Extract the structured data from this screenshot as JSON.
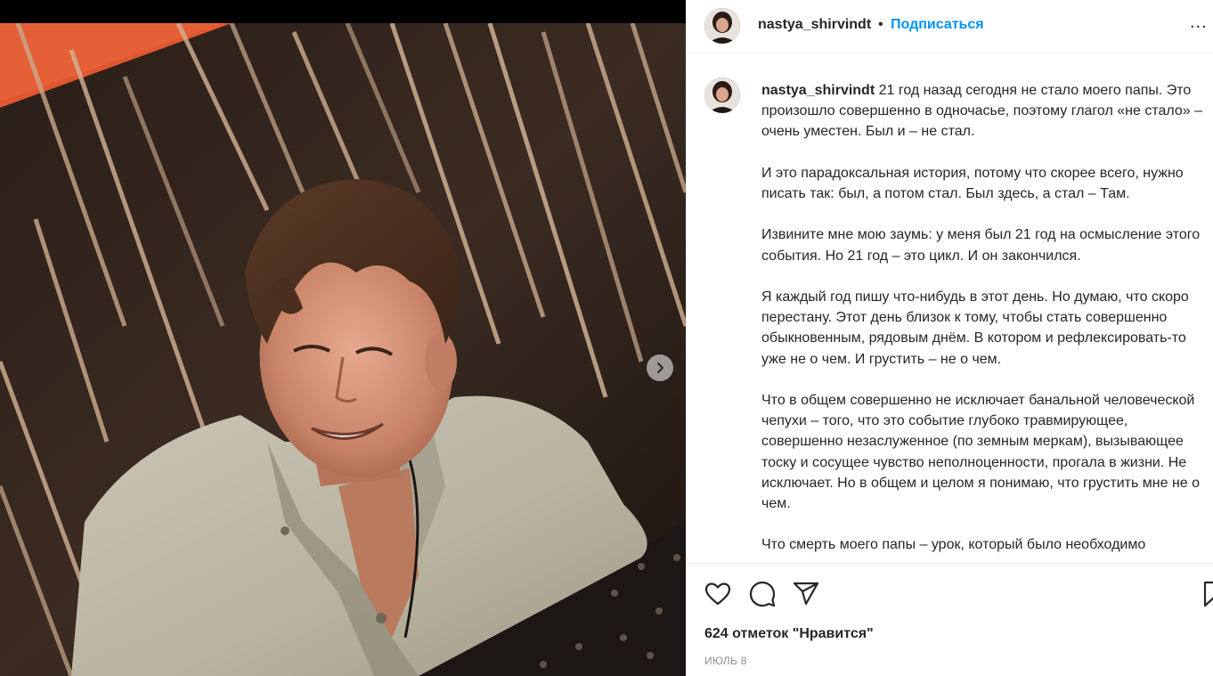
{
  "post": {
    "username": "nastya_shirvindt",
    "separator": "•",
    "follow_label": "Подписаться",
    "more_label": "...",
    "caption_user": "nastya_shirvindt",
    "caption_paragraphs": [
      "21 год назад сегодня не стало моего папы. Это произошло совершенно в одночасье, поэтому глагол «не стало» – очень уместен. Был и – не стал.",
      "И это парадоксальная история, потому что скорее всего, нужно писать так: был, а потом стал. Был здесь, а стал – Там.",
      "Извините мне мою заумь: у меня был 21 год на осмысление этого события. Но 21 год – это цикл. И он закончился.",
      "Я каждый год пишу что-нибудь в этот день. Но думаю, что скоро перестану. Этот день близок к тому, чтобы стать совершенно обыкновенным, рядовым днём. В котором и рефлексировать-то уже не о чем. И грустить – не о чем.",
      "Что в общем совершенно не исключает банальной человеческой чепухи – того, что это событие глубоко травмирующее, совершенно незаслуженное (по земным меркам), вызывающее тоску и сосущее чувство неполноценности, прогала в жизни. Не исключает. Но в общем и целом я понимаю, что грустить мне не о чем.",
      "Что смерть моего папы – урок, который было необходимо"
    ],
    "likes_text": "624 отметок \"Нравится\"",
    "date_text": "Июль 8"
  },
  "icons": {
    "like": "heart-icon",
    "comment": "comment-icon",
    "share": "paper-plane-icon",
    "save": "bookmark-icon",
    "next": "chevron-right-icon"
  },
  "colors": {
    "accent": "#0095f6",
    "text": "#262626",
    "muted": "#8e8e8e",
    "border": "#efefef"
  }
}
